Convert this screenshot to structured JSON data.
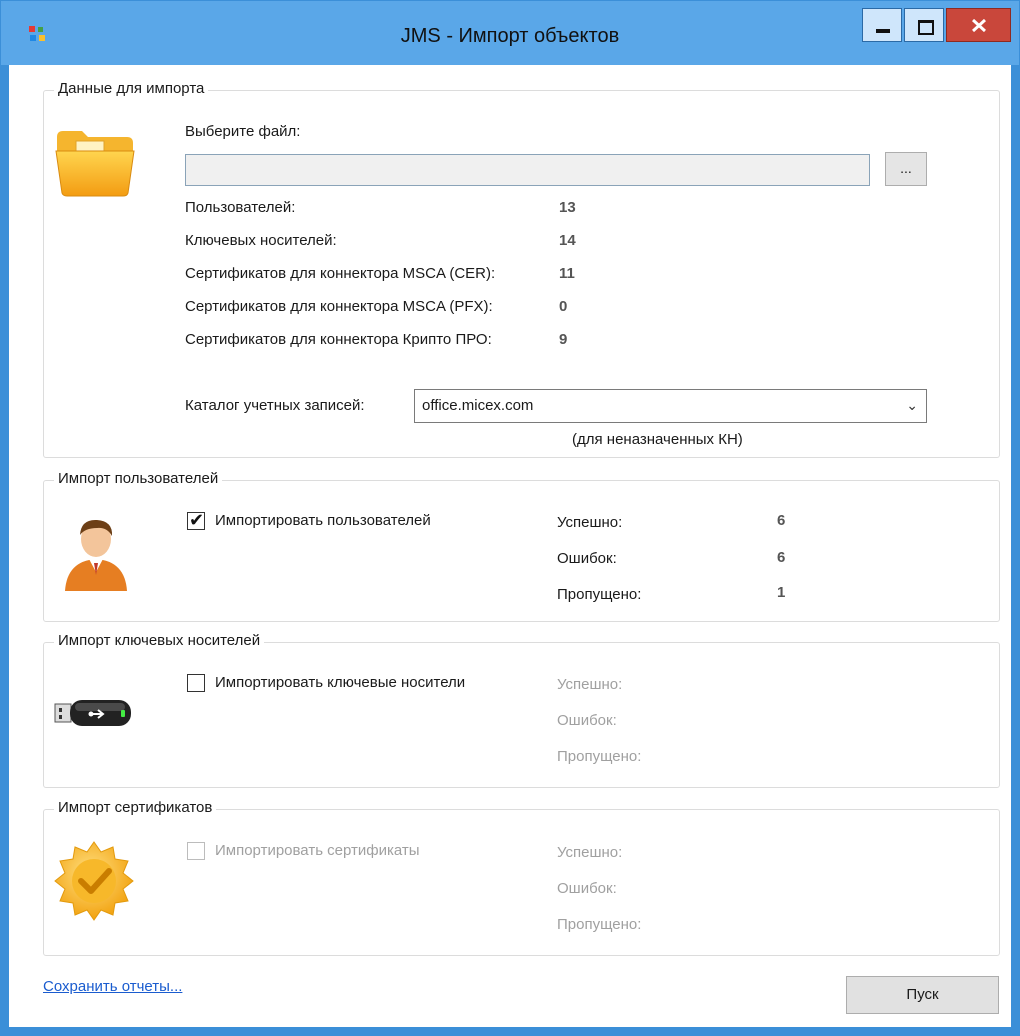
{
  "window": {
    "title": "JMS - Импорт объектов"
  },
  "import_data": {
    "group_label": "Данные для импорта",
    "select_file_label": "Выберите файл:",
    "file_value": "",
    "browse_label": "...",
    "stats": [
      {
        "label": "Пользователей:",
        "value": "13"
      },
      {
        "label": "Ключевых носителей:",
        "value": "14"
      },
      {
        "label": "Сертификатов для коннектора MSCA (CER):",
        "value": "11"
      },
      {
        "label": "Сертификатов для коннектора MSCA (PFX):",
        "value": "0"
      },
      {
        "label": "Сертификатов для коннектора Крипто ПРО:",
        "value": "9"
      }
    ],
    "catalog_label": "Каталог учетных записей:",
    "catalog_value": "office.micex.com",
    "catalog_hint": "(для неназначенных КН)"
  },
  "users": {
    "group_label": "Импорт пользователей",
    "checkbox_label": "Импортировать пользователей",
    "checked": true,
    "success_label": "Успешно:",
    "success_value": "6",
    "errors_label": "Ошибок:",
    "errors_value": "6",
    "skipped_label": "Пропущено:",
    "skipped_value": "1"
  },
  "tokens": {
    "group_label": "Импорт ключевых носителей",
    "checkbox_label": "Импортировать ключевые носители",
    "checked": false,
    "success_label": "Успешно:",
    "errors_label": "Ошибок:",
    "skipped_label": "Пропущено:"
  },
  "certs": {
    "group_label": "Импорт сертификатов",
    "checkbox_label": "Импортировать сертификаты",
    "checked": false,
    "success_label": "Успешно:",
    "errors_label": "Ошибок:",
    "skipped_label": "Пропущено:"
  },
  "footer": {
    "save_reports_link": "Сохранить отчеты...",
    "run_button": "Пуск"
  },
  "icons": {
    "app": "app-icon",
    "folder": "folder-icon",
    "user": "user-icon",
    "usb": "usb-token-icon",
    "cert": "certificate-seal-icon",
    "chevron": "chevron-down-icon"
  }
}
